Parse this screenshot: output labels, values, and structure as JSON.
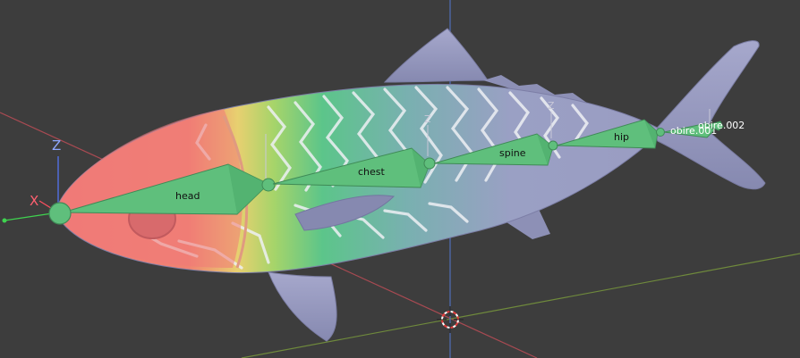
{
  "viewport": {
    "background_color": "#3d3d3d",
    "axis_labels": {
      "z": "Z",
      "x": "X"
    },
    "cursor_icon": "3d-cursor-icon"
  },
  "armature": {
    "bone_color": "#5fbf7c",
    "bones": [
      {
        "name": "head"
      },
      {
        "name": "chest"
      },
      {
        "name": "spine"
      },
      {
        "name": "hip"
      },
      {
        "name": "obire.001"
      },
      {
        "name": "obire.002"
      }
    ],
    "bone_axis_label": "Z"
  },
  "mesh": {
    "name": "fish",
    "body_color": "#9a9cc2",
    "head_color": "#f07a78"
  }
}
